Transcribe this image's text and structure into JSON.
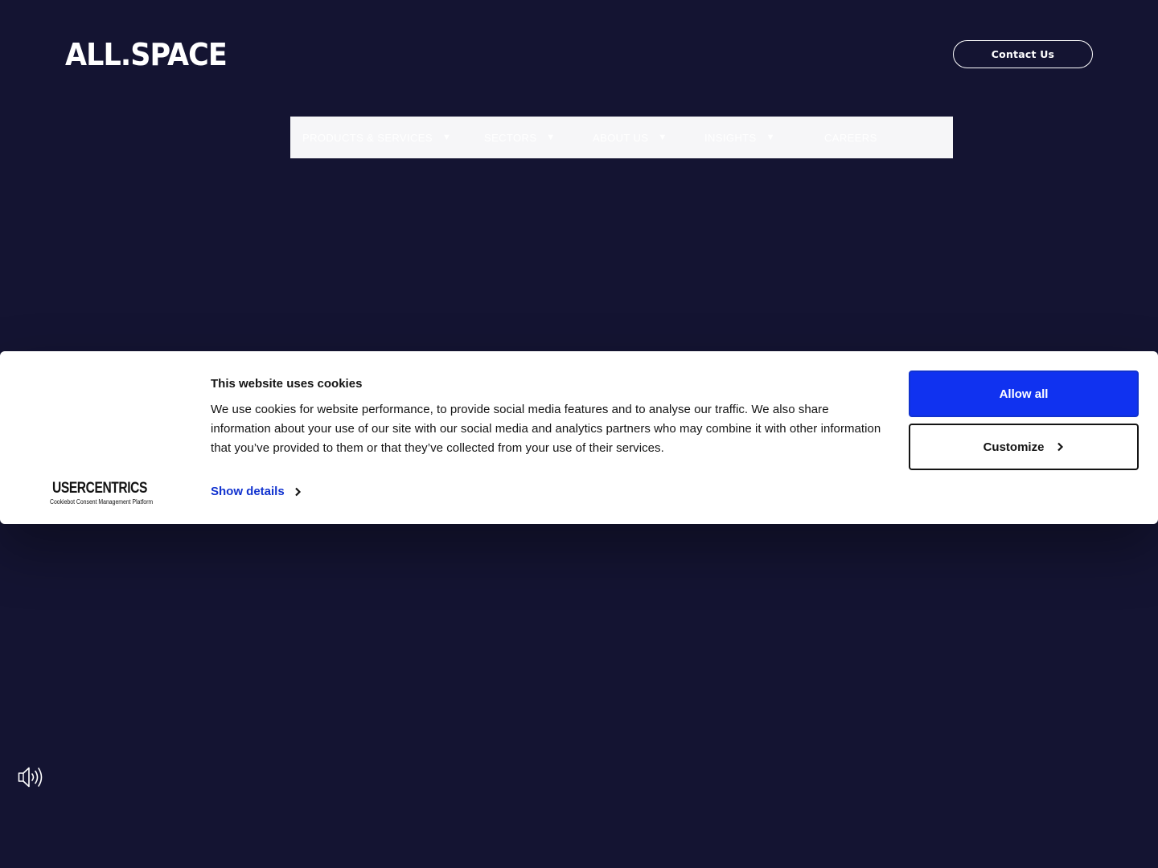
{
  "header": {
    "logo_text": "ALL.SPACE",
    "contact_label": "Contact Us"
  },
  "nav": {
    "items": [
      {
        "label": "PRODUCTS & SERVICES",
        "has_dropdown": true
      },
      {
        "label": "SECTORS",
        "has_dropdown": true
      },
      {
        "label": "ABOUT US",
        "has_dropdown": true
      },
      {
        "label": "INSIGHTS",
        "has_dropdown": true
      },
      {
        "label": "CAREERS",
        "has_dropdown": false
      }
    ],
    "caret_glyph": "▼"
  },
  "cookie_banner": {
    "brand_name": "USERCENTRICS",
    "brand_subtitle": "Cookiebot Consent Management Platform",
    "title": "This website uses cookies",
    "body": "We use cookies for website performance, to provide social media features and to analyse our traffic. We also share information about your use of our site with our social media and analytics partners who may combine it with other information that you’ve provided to them or that they’ve collected from your use of their services.",
    "show_details_label": "Show details",
    "allow_all_label": "Allow all",
    "customize_label": "Customize"
  },
  "colors": {
    "page_background": "#141432",
    "nav_background": "#f6f6f8",
    "allow_button": "#1032f0",
    "link_blue": "#1032cf"
  },
  "icons": {
    "sound": "speaker-icon",
    "chevron": "chevron-right-icon"
  }
}
